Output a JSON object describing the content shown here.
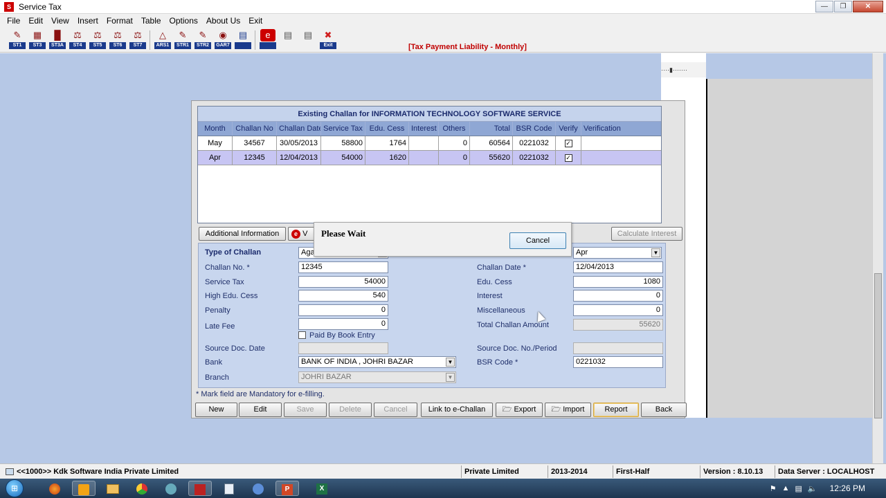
{
  "window": {
    "title": "Service Tax",
    "controls": [
      "minimize",
      "restore",
      "close"
    ]
  },
  "menu": [
    "File",
    "Edit",
    "View",
    "Insert",
    "Format",
    "Table",
    "Options",
    "About Us",
    "Exit"
  ],
  "toolbar": {
    "buttons": [
      {
        "tag": "ST1",
        "icon": "pen-icon"
      },
      {
        "tag": "ST3",
        "icon": "calendar-icon"
      },
      {
        "tag": "ST3A",
        "icon": "book-icon"
      },
      {
        "tag": "ST4",
        "icon": "scales-icon"
      },
      {
        "tag": "ST5",
        "icon": "scales-icon"
      },
      {
        "tag": "ST6",
        "icon": "scales-icon"
      },
      {
        "tag": "ST7",
        "icon": "scales-icon"
      },
      {
        "tag": "ARS1",
        "icon": "chart-icon"
      },
      {
        "tag": "STR1",
        "icon": "pen-icon"
      },
      {
        "tag": "STR2",
        "icon": "pen-icon"
      },
      {
        "tag": "GAR7",
        "icon": "money-bag-icon"
      },
      {
        "tag": "",
        "icon": "document-icon"
      },
      {
        "tag": "",
        "icon": "e-challan-icon"
      },
      {
        "tag": "",
        "icon": "report-icon"
      },
      {
        "tag": "",
        "icon": "report-icon"
      },
      {
        "tag": "Exit",
        "icon": "exit-icon"
      }
    ],
    "liability_label": "[Tax Payment Liability -  Monthly]"
  },
  "grid": {
    "caption": "Existing Challan  for INFORMATION TECHNOLOGY SOFTWARE SERVICE",
    "columns": [
      "Month",
      "Challan No",
      "Challan Date",
      "Service Tax",
      "Edu. Cess",
      "Interest",
      "Others",
      "Total",
      "BSR Code",
      "Verify",
      "Verification"
    ],
    "rows": [
      {
        "month": "May",
        "challan_no": "34567",
        "challan_date": "30/05/2013",
        "service_tax": "58800",
        "edu_cess": "1764",
        "interest": "",
        "others": "0",
        "total": "60564",
        "bsr_code": "0221032",
        "verify": true,
        "verification": ""
      },
      {
        "month": "Apr",
        "challan_no": "12345",
        "challan_date": "12/04/2013",
        "service_tax": "54000",
        "edu_cess": "1620",
        "interest": "",
        "others": "0",
        "total": "55620",
        "bsr_code": "0221032",
        "verify": true,
        "verification": ""
      }
    ]
  },
  "subbuttons": {
    "additional_info": "Additional Information",
    "v": "V",
    "calculate_interest": "Calculate Interest"
  },
  "form": {
    "type_of_challan_label": "Type of Challan",
    "type_of_challan_value": "Aga",
    "month_value": "Apr",
    "challan_no_label": "Challan No. *",
    "challan_no_value": "12345",
    "challan_date_label": "Challan Date *",
    "challan_date_value": "12/04/2013",
    "service_tax_label": "Service Tax",
    "service_tax_value": "54000",
    "edu_cess_label": "Edu. Cess",
    "edu_cess_value": "1080",
    "high_edu_cess_label": "High Edu. Cess",
    "high_edu_cess_value": "540",
    "interest_label": "Interest",
    "interest_value": "0",
    "penalty_label": "Penalty",
    "penalty_value": "0",
    "misc_label": "Miscellaneous",
    "misc_value": "0",
    "late_fee_label": "Late Fee",
    "late_fee_value": "0",
    "total_label": "Total Challan Amount",
    "total_value": "55620",
    "paid_by_book_label": "Paid By Book Entry",
    "source_doc_date_label": "Source Doc. Date",
    "source_doc_no_label": "Source Doc. No./Period",
    "bank_label": "Bank",
    "bank_value": "BANK OF INDIA , JOHRI BAZAR",
    "bsr_code_label": "BSR Code *",
    "bsr_code_value": "0221032",
    "branch_label": "Branch",
    "branch_value": "JOHRI BAZAR",
    "mandatory_note": "* Mark field are Mandatory for e-filling."
  },
  "bottom_buttons": {
    "new": "New",
    "edit": "Edit",
    "save": "Save",
    "delete": "Delete",
    "cancel": "Cancel",
    "link": "Link to e-Challan",
    "export": "Export",
    "import": "Import",
    "report": "Report",
    "back": "Back"
  },
  "dialog": {
    "message": "Please Wait",
    "cancel": "Cancel"
  },
  "status": {
    "company": "<<1000>> Kdk Software India Private Limited",
    "type": "Private Limited",
    "year": "2013-2014",
    "half": "First-Half",
    "version": "Version : 8.10.13",
    "server": "Data Server : LOCALHOST"
  },
  "taskbar": {
    "clock": "12:26 PM"
  },
  "colors": {
    "workspace": "#b6c8e6",
    "grid_header": "#8fa7d4",
    "selected_row": "#c7c5f3",
    "liability_text": "#c00000"
  }
}
